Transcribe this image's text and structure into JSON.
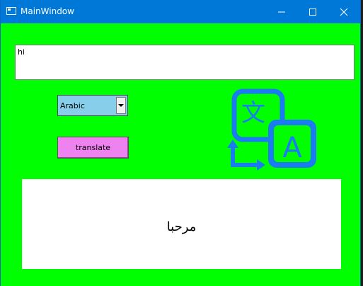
{
  "window": {
    "title": "MainWindow",
    "background_color": "#00ff00",
    "titlebar_color": "#0078d7"
  },
  "controls": {
    "minimize_icon": "minimize-icon",
    "maximize_icon": "maximize-icon",
    "close_icon": "close-icon"
  },
  "input": {
    "value": "hi"
  },
  "language_select": {
    "selected": "Arabic",
    "background_color": "#87ceeb"
  },
  "translate_button": {
    "label": "translate",
    "background_color": "#ee82ee"
  },
  "translate_icon": {
    "name": "translate-icon",
    "color": "#1a7cf0",
    "glyph_top": "文",
    "glyph_bottom": "A"
  },
  "output": {
    "value": "مرحبا"
  }
}
